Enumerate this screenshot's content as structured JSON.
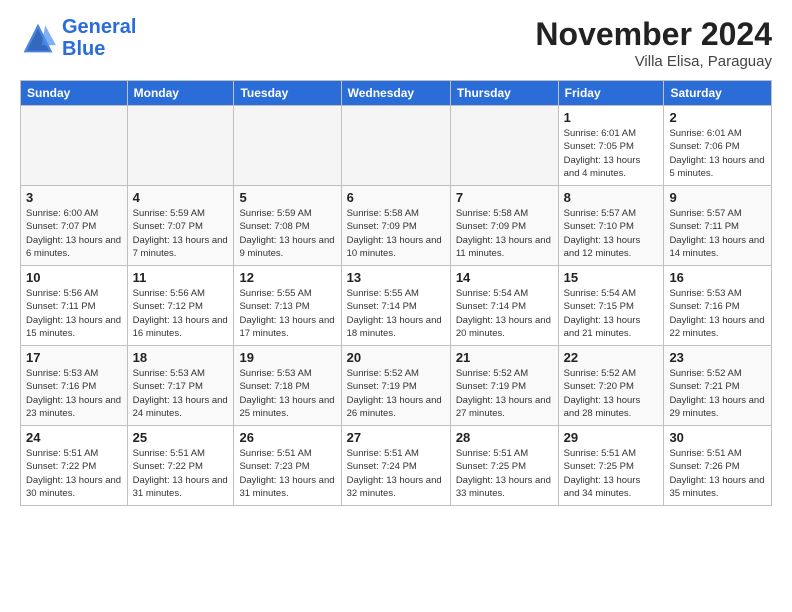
{
  "logo": {
    "line1": "General",
    "line2": "Blue"
  },
  "title": "November 2024",
  "location": "Villa Elisa, Paraguay",
  "weekdays": [
    "Sunday",
    "Monday",
    "Tuesday",
    "Wednesday",
    "Thursday",
    "Friday",
    "Saturday"
  ],
  "weeks": [
    [
      {
        "day": "",
        "info": ""
      },
      {
        "day": "",
        "info": ""
      },
      {
        "day": "",
        "info": ""
      },
      {
        "day": "",
        "info": ""
      },
      {
        "day": "",
        "info": ""
      },
      {
        "day": "1",
        "info": "Sunrise: 6:01 AM\nSunset: 7:05 PM\nDaylight: 13 hours\nand 4 minutes."
      },
      {
        "day": "2",
        "info": "Sunrise: 6:01 AM\nSunset: 7:06 PM\nDaylight: 13 hours\nand 5 minutes."
      }
    ],
    [
      {
        "day": "3",
        "info": "Sunrise: 6:00 AM\nSunset: 7:07 PM\nDaylight: 13 hours\nand 6 minutes."
      },
      {
        "day": "4",
        "info": "Sunrise: 5:59 AM\nSunset: 7:07 PM\nDaylight: 13 hours\nand 7 minutes."
      },
      {
        "day": "5",
        "info": "Sunrise: 5:59 AM\nSunset: 7:08 PM\nDaylight: 13 hours\nand 9 minutes."
      },
      {
        "day": "6",
        "info": "Sunrise: 5:58 AM\nSunset: 7:09 PM\nDaylight: 13 hours\nand 10 minutes."
      },
      {
        "day": "7",
        "info": "Sunrise: 5:58 AM\nSunset: 7:09 PM\nDaylight: 13 hours\nand 11 minutes."
      },
      {
        "day": "8",
        "info": "Sunrise: 5:57 AM\nSunset: 7:10 PM\nDaylight: 13 hours\nand 12 minutes."
      },
      {
        "day": "9",
        "info": "Sunrise: 5:57 AM\nSunset: 7:11 PM\nDaylight: 13 hours\nand 14 minutes."
      }
    ],
    [
      {
        "day": "10",
        "info": "Sunrise: 5:56 AM\nSunset: 7:11 PM\nDaylight: 13 hours\nand 15 minutes."
      },
      {
        "day": "11",
        "info": "Sunrise: 5:56 AM\nSunset: 7:12 PM\nDaylight: 13 hours\nand 16 minutes."
      },
      {
        "day": "12",
        "info": "Sunrise: 5:55 AM\nSunset: 7:13 PM\nDaylight: 13 hours\nand 17 minutes."
      },
      {
        "day": "13",
        "info": "Sunrise: 5:55 AM\nSunset: 7:14 PM\nDaylight: 13 hours\nand 18 minutes."
      },
      {
        "day": "14",
        "info": "Sunrise: 5:54 AM\nSunset: 7:14 PM\nDaylight: 13 hours\nand 20 minutes."
      },
      {
        "day": "15",
        "info": "Sunrise: 5:54 AM\nSunset: 7:15 PM\nDaylight: 13 hours\nand 21 minutes."
      },
      {
        "day": "16",
        "info": "Sunrise: 5:53 AM\nSunset: 7:16 PM\nDaylight: 13 hours\nand 22 minutes."
      }
    ],
    [
      {
        "day": "17",
        "info": "Sunrise: 5:53 AM\nSunset: 7:16 PM\nDaylight: 13 hours\nand 23 minutes."
      },
      {
        "day": "18",
        "info": "Sunrise: 5:53 AM\nSunset: 7:17 PM\nDaylight: 13 hours\nand 24 minutes."
      },
      {
        "day": "19",
        "info": "Sunrise: 5:53 AM\nSunset: 7:18 PM\nDaylight: 13 hours\nand 25 minutes."
      },
      {
        "day": "20",
        "info": "Sunrise: 5:52 AM\nSunset: 7:19 PM\nDaylight: 13 hours\nand 26 minutes."
      },
      {
        "day": "21",
        "info": "Sunrise: 5:52 AM\nSunset: 7:19 PM\nDaylight: 13 hours\nand 27 minutes."
      },
      {
        "day": "22",
        "info": "Sunrise: 5:52 AM\nSunset: 7:20 PM\nDaylight: 13 hours\nand 28 minutes."
      },
      {
        "day": "23",
        "info": "Sunrise: 5:52 AM\nSunset: 7:21 PM\nDaylight: 13 hours\nand 29 minutes."
      }
    ],
    [
      {
        "day": "24",
        "info": "Sunrise: 5:51 AM\nSunset: 7:22 PM\nDaylight: 13 hours\nand 30 minutes."
      },
      {
        "day": "25",
        "info": "Sunrise: 5:51 AM\nSunset: 7:22 PM\nDaylight: 13 hours\nand 31 minutes."
      },
      {
        "day": "26",
        "info": "Sunrise: 5:51 AM\nSunset: 7:23 PM\nDaylight: 13 hours\nand 31 minutes."
      },
      {
        "day": "27",
        "info": "Sunrise: 5:51 AM\nSunset: 7:24 PM\nDaylight: 13 hours\nand 32 minutes."
      },
      {
        "day": "28",
        "info": "Sunrise: 5:51 AM\nSunset: 7:25 PM\nDaylight: 13 hours\nand 33 minutes."
      },
      {
        "day": "29",
        "info": "Sunrise: 5:51 AM\nSunset: 7:25 PM\nDaylight: 13 hours\nand 34 minutes."
      },
      {
        "day": "30",
        "info": "Sunrise: 5:51 AM\nSunset: 7:26 PM\nDaylight: 13 hours\nand 35 minutes."
      }
    ]
  ]
}
